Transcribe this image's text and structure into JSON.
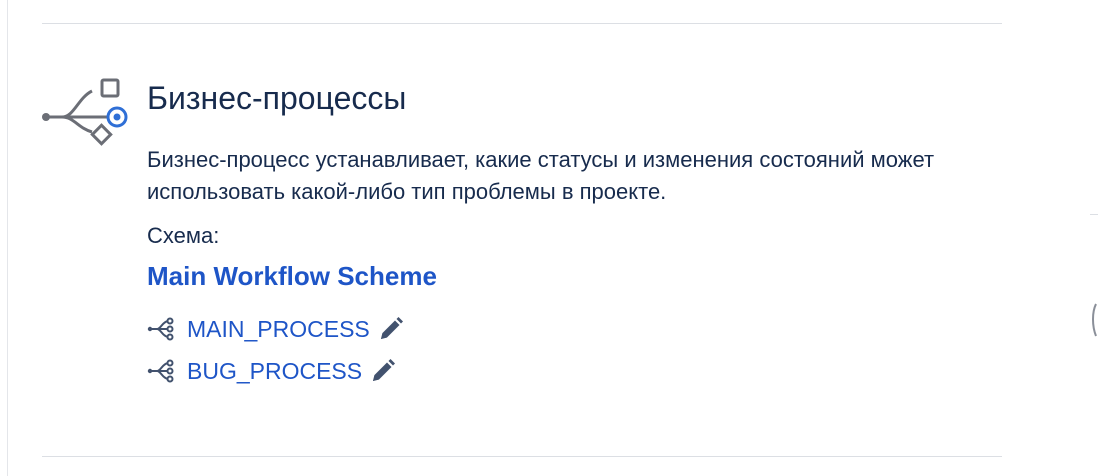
{
  "section": {
    "title": "Бизнес-процессы",
    "description": "Бизнес-процесс устанавливает, какие статусы и изменения состояний может использовать какой-либо тип проблемы в проекте.",
    "icon": "workflow-icon"
  },
  "scheme": {
    "label": "Схема:",
    "link_text": "Main Workflow Scheme"
  },
  "workflows": [
    {
      "name": "MAIN_PROCESS",
      "icon": "share-icon",
      "edit_icon": "pencil-icon"
    },
    {
      "name": "BUG_PROCESS",
      "icon": "share-icon",
      "edit_icon": "pencil-icon"
    }
  ],
  "colors": {
    "text": "#172b4d",
    "link": "#1e55c7",
    "icon_gray": "#6b6e76",
    "icon_accent": "#2f6fd6",
    "divider": "#dcdfe4"
  }
}
